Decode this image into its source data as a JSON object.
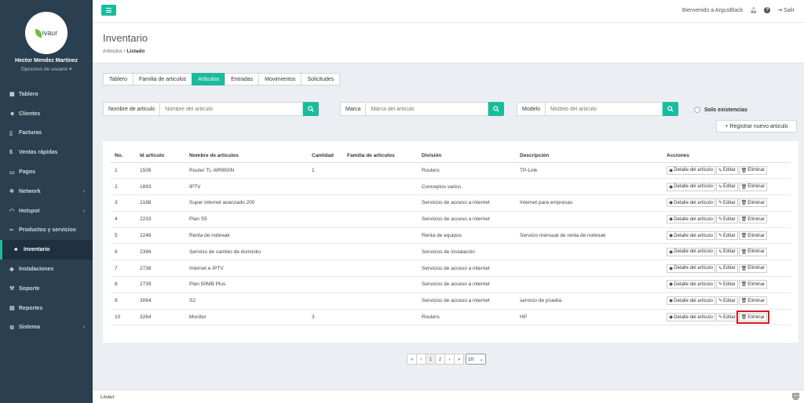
{
  "sidebar": {
    "logo_text": "ivaur",
    "user_name": "Hector Mendez Martinez",
    "user_options": "Opciones de usuario ▾",
    "items": [
      {
        "label": "Tablero",
        "icon": "dashboard-icon"
      },
      {
        "label": "Clientes",
        "icon": "users-icon"
      },
      {
        "label": "Facturas",
        "icon": "file-icon"
      },
      {
        "label": "Ventas rápidas",
        "icon": "dollar-icon"
      },
      {
        "label": "Pagos",
        "icon": "money-icon"
      },
      {
        "label": "Network",
        "icon": "network-icon"
      },
      {
        "label": "Hotspot",
        "icon": "wifi-icon"
      },
      {
        "label": "Productos y servicios",
        "icon": "link-icon"
      },
      {
        "label": "Inventario",
        "icon": "cubes-icon"
      },
      {
        "label": "Instalaciones",
        "icon": "tools-icon"
      },
      {
        "label": "Soporte",
        "icon": "wrench-icon"
      },
      {
        "label": "Reportes",
        "icon": "chart-icon"
      },
      {
        "label": "Sistema",
        "icon": "gears-icon"
      }
    ]
  },
  "topbar": {
    "welcome": "Bienvenido a ArgusBlack",
    "logout": "Salir"
  },
  "header": {
    "title": "Inventario",
    "crumb_parent": "Articulos",
    "crumb_sep": "/",
    "crumb_current": "Listado"
  },
  "tabs": [
    "Tablero",
    "Familia de articulos",
    "Articulos",
    "Entradas",
    "Movimientos",
    "Solicitudes"
  ],
  "search": {
    "nombre_label": "Nombre de articulo",
    "nombre_placeholder": "Nombre del articulo",
    "marca_label": "Marca",
    "marca_placeholder": "Marca del articulo",
    "modelo_label": "Modelo",
    "modelo_placeholder": "Modelo del articulo",
    "solo_existencias": "Solo existencias",
    "new_button": "+ Registrar nuevo articulo"
  },
  "table": {
    "headers": [
      "No.",
      "Id articulo",
      "Nombre de articulos",
      "Cantidad",
      "Familia de articulos",
      "División",
      "Descripción",
      "Acciones"
    ],
    "action_labels": {
      "detail": "Detalle del artículo",
      "edit": "Editar",
      "delete": "Eliminar"
    },
    "rows": [
      {
        "no": "1",
        "id": "1508",
        "name": "Router TL-WR850N",
        "qty": "1",
        "family": "",
        "division": "Routers",
        "desc": "TP-Link"
      },
      {
        "no": "2",
        "id": "1893",
        "name": "IPTV",
        "qty": "",
        "family": "",
        "division": "Conceptos varios",
        "desc": ""
      },
      {
        "no": "3",
        "id": "2188",
        "name": "Super internet avanzado 200",
        "qty": "",
        "family": "",
        "division": "Servicios de acceso a internet",
        "desc": "Internet para empresas"
      },
      {
        "no": "4",
        "id": "2233",
        "name": "Plan S5",
        "qty": "",
        "family": "",
        "division": "Servicios de acceso a internet",
        "desc": ""
      },
      {
        "no": "5",
        "id": "2248",
        "name": "Renta de nobreak",
        "qty": "",
        "family": "",
        "division": "Renta de equipos",
        "desc": "Servicio mensual de renta de nobreak"
      },
      {
        "no": "6",
        "id": "2394",
        "name": "Servicio de cambio de domicilio",
        "qty": "",
        "family": "",
        "division": "Servicios de instalación",
        "desc": ""
      },
      {
        "no": "7",
        "id": "2738",
        "name": "Internet e IPTV",
        "qty": "",
        "family": "",
        "division": "Servicios de acceso a internet",
        "desc": ""
      },
      {
        "no": "8",
        "id": "2739",
        "name": "Plan 50MB Plus",
        "qty": "",
        "family": "",
        "division": "Servicios de acceso a internet",
        "desc": ""
      },
      {
        "no": "9",
        "id": "3064",
        "name": "S2",
        "qty": "",
        "family": "",
        "division": "Servicios de acceso a internet",
        "desc": "servicio de prueba"
      },
      {
        "no": "10",
        "id": "3264",
        "name": "Monitor",
        "qty": "3",
        "family": "",
        "division": "Routers",
        "desc": "HP"
      }
    ]
  },
  "pagination": {
    "first": "«",
    "prev": "‹",
    "pages": [
      "1",
      "2"
    ],
    "next": "›",
    "last": "»",
    "page_size": "10"
  },
  "footer": {
    "text": "Livaur"
  },
  "colors": {
    "accent": "#1abc9c",
    "sidebar": "#2a3f4f",
    "highlight": "#d7191e"
  }
}
